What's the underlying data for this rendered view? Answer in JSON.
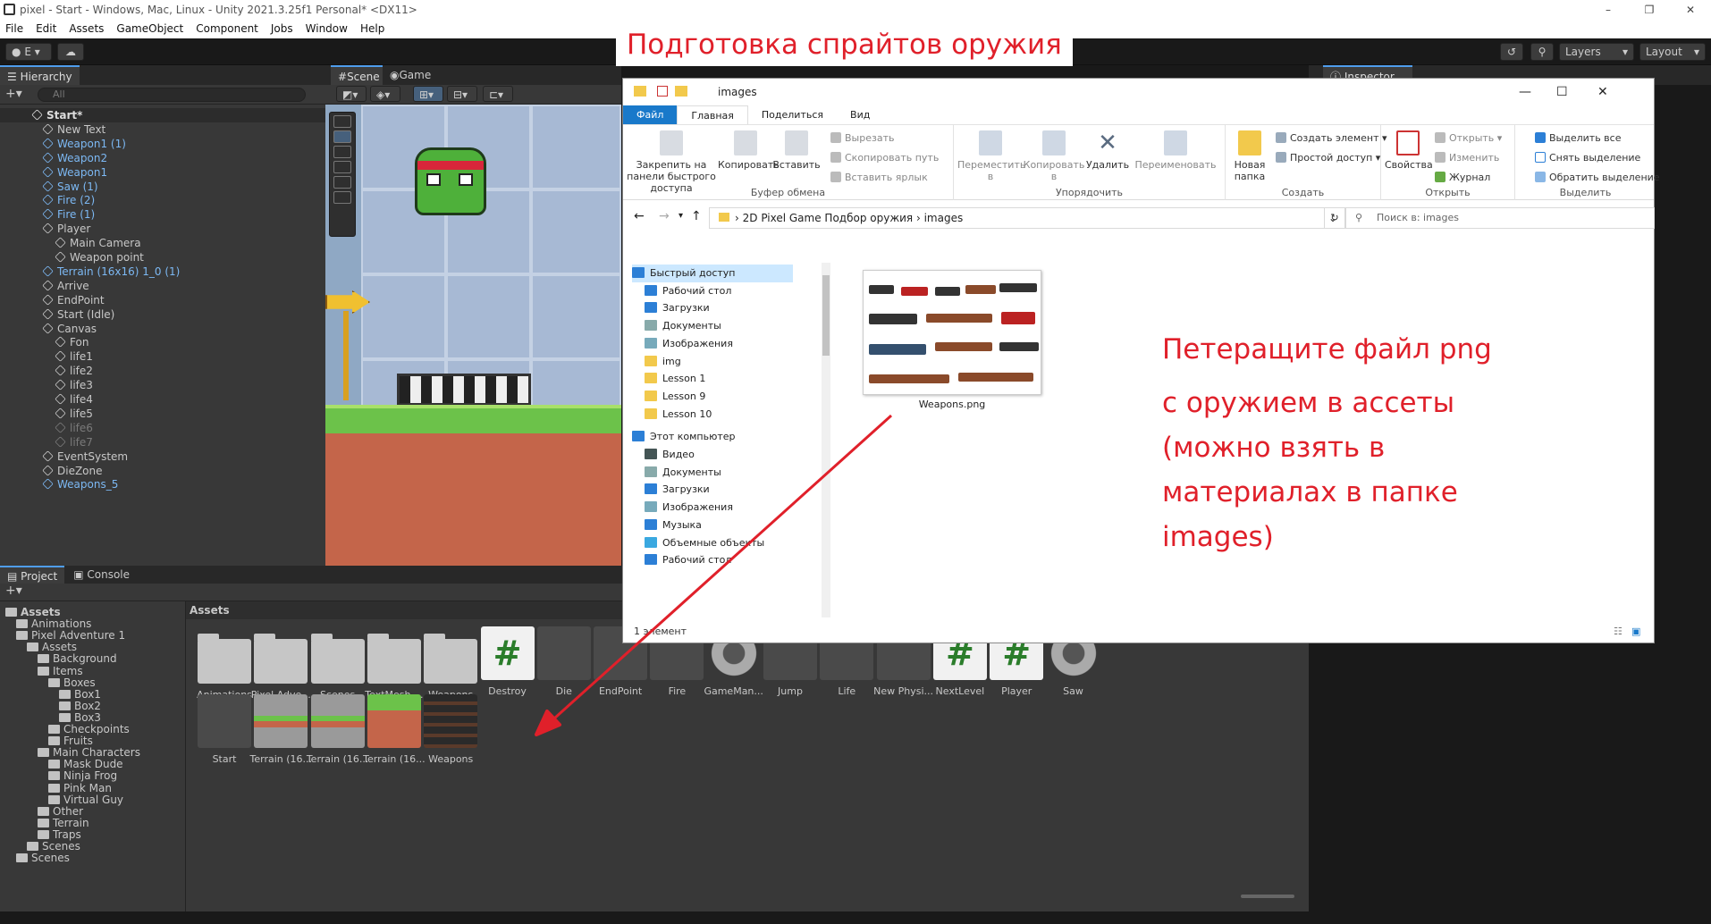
{
  "window": {
    "title": "pixel - Start - Windows, Mac, Linux - Unity 2021.3.25f1 Personal* <DX11>",
    "controls": [
      "–",
      "❐",
      "✕"
    ]
  },
  "menu": [
    "File",
    "Edit",
    "Assets",
    "GameObject",
    "Component",
    "Jobs",
    "Window",
    "Help"
  ],
  "toolbar": {
    "account": "E",
    "layers": "Layers",
    "layout": "Layout"
  },
  "hierarchy": {
    "tab": "Hierarchy",
    "search_placeholder": "All",
    "rows": [
      {
        "label": "Start*",
        "indent": 0,
        "style": "scene"
      },
      {
        "label": "New Text",
        "indent": 1,
        "style": "normal"
      },
      {
        "label": "Weapon1 (1)",
        "indent": 1,
        "style": "blue"
      },
      {
        "label": "Weapon2",
        "indent": 1,
        "style": "blue"
      },
      {
        "label": "Weapon1",
        "indent": 1,
        "style": "blue"
      },
      {
        "label": "Saw (1)",
        "indent": 1,
        "style": "blue"
      },
      {
        "label": "Fire (2)",
        "indent": 1,
        "style": "blue"
      },
      {
        "label": "Fire (1)",
        "indent": 1,
        "style": "blue"
      },
      {
        "label": "Player",
        "indent": 1,
        "style": "normal"
      },
      {
        "label": "Main Camera",
        "indent": 2,
        "style": "normal"
      },
      {
        "label": "Weapon point",
        "indent": 2,
        "style": "normal"
      },
      {
        "label": "Terrain (16x16) 1_0 (1)",
        "indent": 1,
        "style": "blue"
      },
      {
        "label": "Arrive",
        "indent": 1,
        "style": "normal"
      },
      {
        "label": "EndPoint",
        "indent": 1,
        "style": "normal"
      },
      {
        "label": "Start (Idle)",
        "indent": 1,
        "style": "normal"
      },
      {
        "label": "Canvas",
        "indent": 1,
        "style": "normal"
      },
      {
        "label": "Fon",
        "indent": 2,
        "style": "normal"
      },
      {
        "label": "life1",
        "indent": 2,
        "style": "normal"
      },
      {
        "label": "life2",
        "indent": 2,
        "style": "normal"
      },
      {
        "label": "life3",
        "indent": 2,
        "style": "normal"
      },
      {
        "label": "life4",
        "indent": 2,
        "style": "normal"
      },
      {
        "label": "life5",
        "indent": 2,
        "style": "normal"
      },
      {
        "label": "life6",
        "indent": 2,
        "style": "dim"
      },
      {
        "label": "life7",
        "indent": 2,
        "style": "dim"
      },
      {
        "label": "EventSystem",
        "indent": 1,
        "style": "normal"
      },
      {
        "label": "DieZone",
        "indent": 1,
        "style": "normal"
      },
      {
        "label": "Weapons_5",
        "indent": 1,
        "style": "blue"
      }
    ]
  },
  "scene_tabs": {
    "scene": "Scene",
    "game": "Game"
  },
  "inspector_tab": "Inspector",
  "project": {
    "tab_project": "Project",
    "tab_console": "Console",
    "breadcrumb": "Assets",
    "tree": [
      {
        "label": "Assets",
        "indent": 0
      },
      {
        "label": "Animations",
        "indent": 1
      },
      {
        "label": "Pixel Adventure 1",
        "indent": 1
      },
      {
        "label": "Assets",
        "indent": 2
      },
      {
        "label": "Background",
        "indent": 3
      },
      {
        "label": "Items",
        "indent": 3
      },
      {
        "label": "Boxes",
        "indent": 4
      },
      {
        "label": "Box1",
        "indent": 5
      },
      {
        "label": "Box2",
        "indent": 5
      },
      {
        "label": "Box3",
        "indent": 5
      },
      {
        "label": "Checkpoints",
        "indent": 4
      },
      {
        "label": "Fruits",
        "indent": 4
      },
      {
        "label": "Main Characters",
        "indent": 3
      },
      {
        "label": "Mask Dude",
        "indent": 4
      },
      {
        "label": "Ninja Frog",
        "indent": 4
      },
      {
        "label": "Pink Man",
        "indent": 4
      },
      {
        "label": "Virtual Guy",
        "indent": 4
      },
      {
        "label": "Other",
        "indent": 3
      },
      {
        "label": "Terrain",
        "indent": 3
      },
      {
        "label": "Traps",
        "indent": 3
      },
      {
        "label": "Scenes",
        "indent": 2
      },
      {
        "label": "Scenes",
        "indent": 1
      }
    ],
    "assets_row1": [
      {
        "label": "Animations",
        "kind": "folder"
      },
      {
        "label": "Pixel Adve...",
        "kind": "folder"
      },
      {
        "label": "Scenes",
        "kind": "folder"
      },
      {
        "label": "TextMesh ...",
        "kind": "folder"
      },
      {
        "label": "Weapons",
        "kind": "folder"
      },
      {
        "label": "Destroy",
        "kind": "script"
      },
      {
        "label": "Die",
        "kind": "sprite"
      },
      {
        "label": "EndPoint",
        "kind": "sprite"
      },
      {
        "label": "Fire",
        "kind": "sprite"
      },
      {
        "label": "GameMan...",
        "kind": "gear"
      },
      {
        "label": "Jump",
        "kind": "sprite"
      },
      {
        "label": "Life",
        "kind": "sprite"
      },
      {
        "label": "New Physi...",
        "kind": "sprite"
      },
      {
        "label": "NextLevel",
        "kind": "script"
      },
      {
        "label": "Player",
        "kind": "script"
      },
      {
        "label": "Saw",
        "kind": "gear"
      }
    ],
    "assets_row2": [
      {
        "label": "Start",
        "kind": "sprite"
      },
      {
        "label": "Terrain (16...",
        "kind": "terrain"
      },
      {
        "label": "Terrain (16...",
        "kind": "terrain"
      },
      {
        "label": "Terrain (16...",
        "kind": "ground"
      },
      {
        "label": "Weapons",
        "kind": "weapons"
      }
    ]
  },
  "explorer": {
    "title": "images",
    "tabs": [
      "Файл",
      "Главная",
      "Поделиться",
      "Вид"
    ],
    "ribbon": {
      "pin": "Закрепить на панели быстрого доступа",
      "copy": "Копировать",
      "paste": "Вставить",
      "cut": "Вырезать",
      "copy_path": "Скопировать путь",
      "paste_shortcut": "Вставить ярлык",
      "clipboard": "Буфер обмена",
      "move_to": "Переместить в",
      "copy_to": "Копировать в",
      "delete": "Удалить",
      "rename": "Переименовать",
      "organize": "Упорядочить",
      "new_folder": "Новая папка",
      "new_item": "Создать элемент",
      "easy_access": "Простой доступ",
      "create": "Создать",
      "properties": "Свойства",
      "open": "Открыть",
      "edit": "Изменить",
      "history": "Журнал",
      "open_group": "Открыть",
      "select_all": "Выделить все",
      "select_none": "Снять выделение",
      "invert": "Обратить выделение",
      "select": "Выделить"
    },
    "path": [
      "2D Pixel Game Подбор оружия",
      "images"
    ],
    "search_placeholder": "Поиск в: images",
    "nav": [
      {
        "label": "Быстрый доступ",
        "icon": "star",
        "selected": true,
        "indent": 0
      },
      {
        "label": "Рабочий стол",
        "icon": "desktop",
        "indent": 1
      },
      {
        "label": "Загрузки",
        "icon": "download",
        "indent": 1
      },
      {
        "label": "Документы",
        "icon": "doc",
        "indent": 1
      },
      {
        "label": "Изображения",
        "icon": "image",
        "indent": 1
      },
      {
        "label": "img",
        "icon": "folder",
        "indent": 1
      },
      {
        "label": "Lesson 1",
        "icon": "folder",
        "indent": 1
      },
      {
        "label": "Lesson 9",
        "icon": "folder",
        "indent": 1
      },
      {
        "label": "Lesson 10",
        "icon": "folder",
        "indent": 1
      },
      {
        "label": "Этот компьютер",
        "icon": "pc",
        "indent": 0
      },
      {
        "label": "Видео",
        "icon": "video",
        "indent": 1
      },
      {
        "label": "Документы",
        "icon": "doc",
        "indent": 1
      },
      {
        "label": "Загрузки",
        "icon": "download",
        "indent": 1
      },
      {
        "label": "Изображения",
        "icon": "image",
        "indent": 1
      },
      {
        "label": "Музыка",
        "icon": "music",
        "indent": 1
      },
      {
        "label": "Объемные объекты",
        "icon": "cube",
        "indent": 1
      },
      {
        "label": "Рабочий стол",
        "icon": "desktop",
        "indent": 1
      }
    ],
    "file": "Weapons.png",
    "status": "1 элемент"
  },
  "annotations": {
    "heading": "Подготовка спрайтов оружия",
    "lines": [
      "Петеращите файл png",
      "с оружием в ассеты",
      "(можно взять в",
      "материалах в папке",
      "images)"
    ]
  },
  "colors": {
    "annotation": "#e0202a",
    "unity_blue": "#7cb8f3",
    "explorer_accent": "#1979ca"
  }
}
